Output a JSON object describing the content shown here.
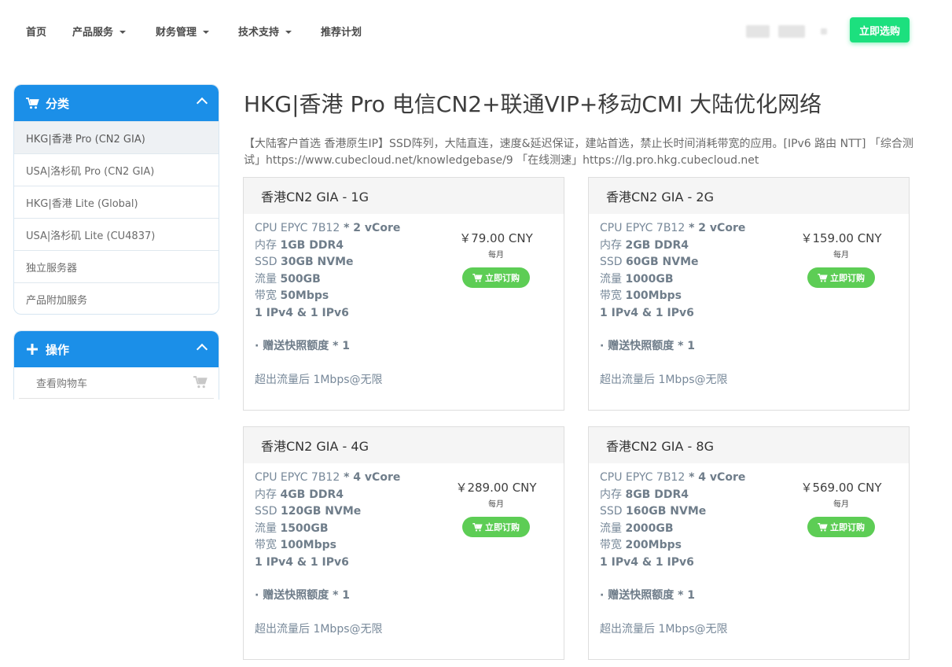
{
  "nav": {
    "items": [
      {
        "label": "首页",
        "dropdown": false
      },
      {
        "label": "产品服务",
        "dropdown": true
      },
      {
        "label": "财务管理",
        "dropdown": true
      },
      {
        "label": "技术支持",
        "dropdown": true
      },
      {
        "label": "推荐计划",
        "dropdown": false
      }
    ],
    "cta_label": "立即选购"
  },
  "sidebar": {
    "categories": {
      "title": "分类",
      "icon": "cart-icon",
      "items": [
        {
          "label": "HKG|香港 Pro (CN2 GIA)",
          "active": true
        },
        {
          "label": "USA|洛杉矶 Pro (CN2 GIA)",
          "active": false
        },
        {
          "label": "HKG|香港 Lite (Global)",
          "active": false
        },
        {
          "label": "USA|洛杉矶 Lite (CU4837)",
          "active": false
        },
        {
          "label": "独立服务器",
          "active": false
        },
        {
          "label": "产品附加服务",
          "active": false
        }
      ]
    },
    "actions": {
      "title": "操作",
      "icon": "plus-icon",
      "items": [
        {
          "label": "查看购物车",
          "icon": "cart-icon"
        }
      ]
    }
  },
  "main": {
    "title": "HKG|香港 Pro 电信CN2+联通VIP+移动CMI 大陆优化网络",
    "description": "【大陆客户首选 香港原生IP】SSD阵列，大陆直连，速度&延迟保证，建站首选，禁止长时间消耗带宽的应用。[IPv6 路由 NTT] 「综合测试」https://www.cubecloud.net/knowledgebase/9 「在线测速」https://lg.pro.hkg.cubecloud.net",
    "order_label": "立即订购",
    "period_label": "每月",
    "products": [
      {
        "name": "香港CN2 GIA - 1G",
        "price": "￥79.00 CNY",
        "specs": {
          "cpu_label": "CPU EPYC 7B12",
          "cpu_value": " * 2 vCore",
          "mem_label": "内存 ",
          "mem_value": "1GB DDR4",
          "ssd_label": "SSD ",
          "ssd_value": "30GB NVMe",
          "traffic_label": "流量 ",
          "traffic_value": "500GB",
          "bw_label": "带宽 ",
          "bw_value": "50Mbps",
          "ip": "1 IPv4 & 1 IPv6",
          "snapshot": "· 赠送快照额度 * 1",
          "overage": "超出流量后 1Mbps@无限"
        }
      },
      {
        "name": "香港CN2 GIA - 2G",
        "price": "￥159.00 CNY",
        "specs": {
          "cpu_label": "CPU EPYC 7B12",
          "cpu_value": " * 2 vCore",
          "mem_label": "内存 ",
          "mem_value": "2GB DDR4",
          "ssd_label": "SSD ",
          "ssd_value": "60GB NVMe",
          "traffic_label": "流量 ",
          "traffic_value": "1000GB",
          "bw_label": "带宽 ",
          "bw_value": "100Mbps",
          "ip": "1 IPv4 & 1 IPv6",
          "snapshot": "· 赠送快照额度 * 1",
          "overage": "超出流量后 1Mbps@无限"
        }
      },
      {
        "name": "香港CN2 GIA - 4G",
        "price": "￥289.00 CNY",
        "specs": {
          "cpu_label": "CPU EPYC 7B12",
          "cpu_value": " * 4 vCore",
          "mem_label": "内存 ",
          "mem_value": "4GB DDR4",
          "ssd_label": "SSD ",
          "ssd_value": "120GB NVMe",
          "traffic_label": "流量 ",
          "traffic_value": "1500GB",
          "bw_label": "带宽 ",
          "bw_value": "100Mbps",
          "ip": "1 IPv4 & 1 IPv6",
          "snapshot": "· 赠送快照额度 * 1",
          "overage": "超出流量后 1Mbps@无限"
        }
      },
      {
        "name": "香港CN2 GIA - 8G",
        "price": "￥569.00 CNY",
        "specs": {
          "cpu_label": "CPU EPYC 7B12",
          "cpu_value": " * 4 vCore",
          "mem_label": "内存 ",
          "mem_value": "8GB DDR4",
          "ssd_label": "SSD ",
          "ssd_value": "160GB NVMe",
          "traffic_label": "流量 ",
          "traffic_value": "2000GB",
          "bw_label": "带宽 ",
          "bw_value": "200Mbps",
          "ip": "1 IPv4 & 1 IPv6",
          "snapshot": "· 赠送快照额度 * 1",
          "overage": "超出流量后 1Mbps@无限"
        }
      }
    ]
  },
  "colors": {
    "accent_blue": "#1b8fe8",
    "cta_green": "#1ce07e",
    "order_green": "#5dcd55"
  }
}
